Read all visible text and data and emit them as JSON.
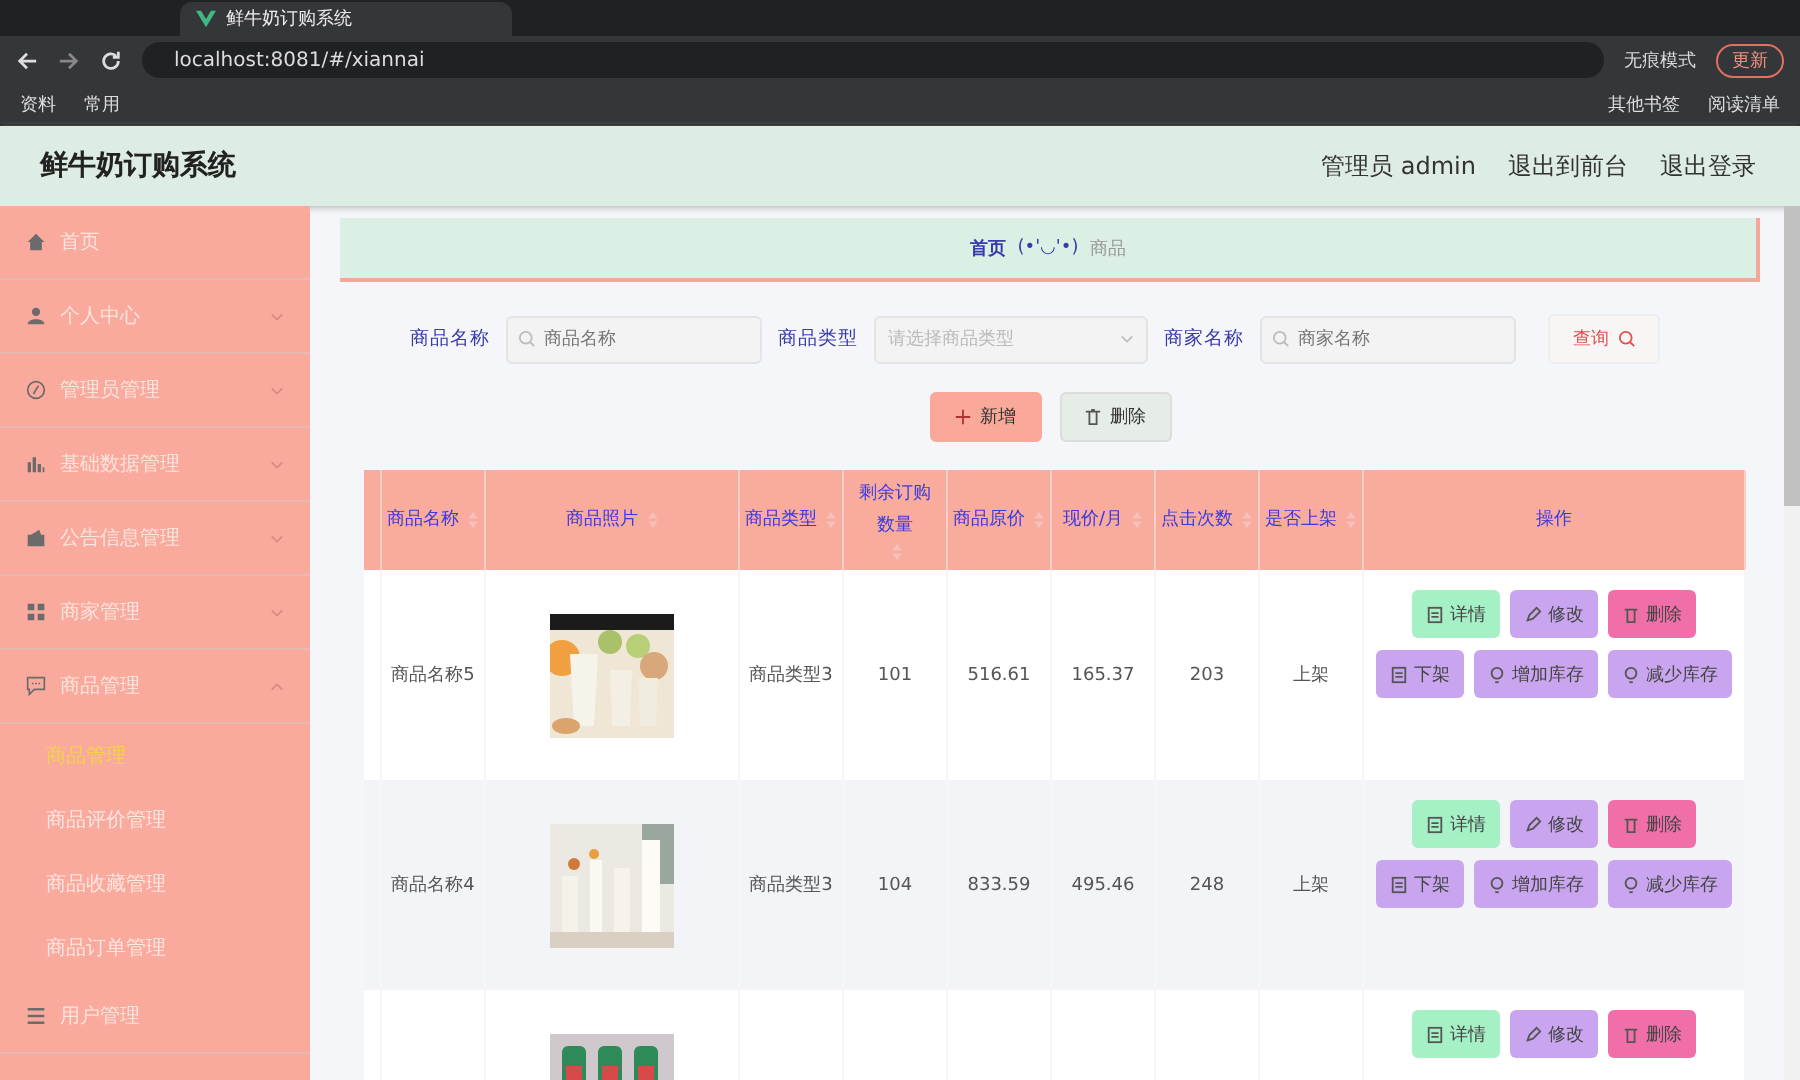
{
  "browser": {
    "tab_title": "鲜牛奶订购系统",
    "url": "localhost:8081/#/xiannai",
    "profile": "无痕模式",
    "update": "更新",
    "bookmarks": [
      "资料",
      "常用"
    ],
    "bookmarks_right": [
      "其他书签",
      "阅读清单"
    ]
  },
  "header": {
    "title": "鲜牛奶订购系统",
    "links": [
      "管理员 admin",
      "退出到前台",
      "退出登录"
    ]
  },
  "sidebar": {
    "items": [
      {
        "label": "首页",
        "kind": "link"
      },
      {
        "label": "个人中心",
        "kind": "group",
        "expanded": false
      },
      {
        "label": "管理员管理",
        "kind": "group",
        "expanded": false
      },
      {
        "label": "基础数据管理",
        "kind": "group",
        "expanded": false
      },
      {
        "label": "公告信息管理",
        "kind": "group",
        "expanded": false
      },
      {
        "label": "商家管理",
        "kind": "group",
        "expanded": false
      },
      {
        "label": "商品管理",
        "kind": "group",
        "expanded": true,
        "children": [
          {
            "label": "商品管理",
            "selected": true
          },
          {
            "label": "商品评价管理",
            "selected": false
          },
          {
            "label": "商品收藏管理",
            "selected": false
          },
          {
            "label": "商品订单管理",
            "selected": false
          }
        ]
      },
      {
        "label": "用户管理",
        "kind": "link"
      }
    ]
  },
  "breadcrumb": {
    "home": "首页",
    "separator": "(•'◡'•)",
    "current": "商品"
  },
  "search": {
    "fields": [
      {
        "label": "商品名称",
        "kind": "input",
        "placeholder": "商品名称"
      },
      {
        "label": "商品类型",
        "kind": "select",
        "placeholder": "请选择商品类型"
      },
      {
        "label": "商家名称",
        "kind": "input",
        "placeholder": "商家名称"
      }
    ],
    "submit": "查询"
  },
  "buttons": [
    {
      "label": "新增",
      "kind": "add"
    },
    {
      "label": "删除",
      "kind": "delete"
    }
  ],
  "table": {
    "columns": [
      "商品名称",
      "商品照片",
      "商品类型",
      "剩余订购数量",
      "商品原价",
      "现价/月",
      "点击次数",
      "是否上架",
      "操作"
    ],
    "rows": [
      {
        "name": "商品名称5",
        "photo": {
          "kind": "picture"
        },
        "type": "商品类型3",
        "stock": "101",
        "price": "516.61",
        "current": "165.37",
        "clicks": "203",
        "status": "上架",
        "actions": [
          {
            "label": "详情",
            "kind": "detail"
          },
          {
            "label": "修改",
            "kind": "edit"
          },
          {
            "label": "删除",
            "kind": "delete"
          },
          {
            "label": "下架",
            "kind": "detail2"
          },
          {
            "label": "增加库存",
            "kind": "stock"
          },
          {
            "label": "减少库存",
            "kind": "stock"
          }
        ]
      },
      {
        "name": "商品名称4",
        "photo": {
          "kind": "picture"
        },
        "type": "商品类型3",
        "stock": "104",
        "price": "833.59",
        "current": "495.46",
        "clicks": "248",
        "status": "上架",
        "actions": [
          {
            "label": "详情",
            "kind": "detail"
          },
          {
            "label": "修改",
            "kind": "edit"
          },
          {
            "label": "删除",
            "kind": "delete"
          },
          {
            "label": "下架",
            "kind": "detail2"
          },
          {
            "label": "增加库存",
            "kind": "stock"
          },
          {
            "label": "减少库存",
            "kind": "stock"
          }
        ]
      },
      {
        "photo": {
          "kind": "picture"
        },
        "actions": [
          {
            "label": "详情",
            "kind": "detail"
          },
          {
            "label": "修改",
            "kind": "edit"
          },
          {
            "label": "删除",
            "kind": "delete"
          }
        ]
      }
    ]
  }
}
